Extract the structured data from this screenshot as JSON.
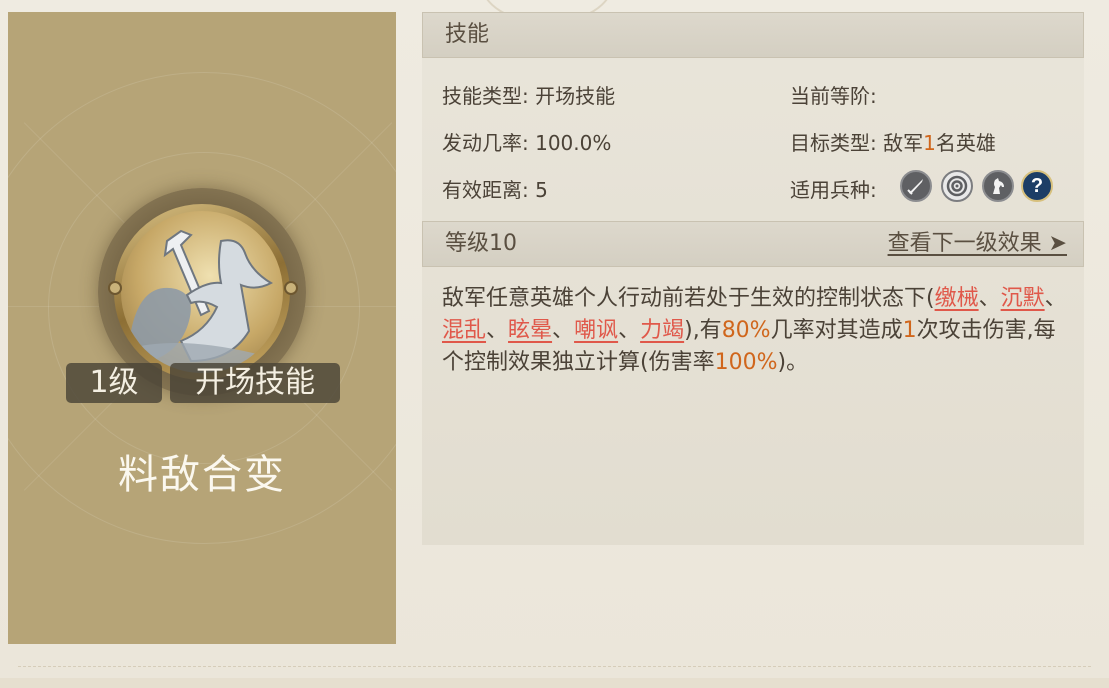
{
  "skill_card": {
    "level_tag": "1级",
    "type_tag": "开场技能",
    "name": "料敌合变"
  },
  "skill_panel": {
    "header": "技能",
    "skill_type_label": "技能类型:",
    "skill_type_value": "开场技能",
    "current_rank_label": "当前等阶:",
    "current_rank_value": "",
    "trigger_rate_label": "发动几率:",
    "trigger_rate_value": "100.0%",
    "target_label": "目标类型:",
    "target_prefix": "敌军",
    "target_count": "1",
    "target_suffix": "名英雄",
    "range_label": "有效距离:",
    "range_value": "5",
    "troops_label": "适用兵种:",
    "troop_icons": [
      "sword-troop-icon",
      "archer-troop-icon",
      "cavalry-troop-icon",
      "unknown-troop-icon"
    ]
  },
  "level_bar": {
    "label": "等级10",
    "next_link": "查看下一级效果 ➤"
  },
  "description": {
    "p1": "敌军任意英雄个人行动前若处于生效的控制状态下(",
    "kw1": "缴械",
    "s1": "、",
    "kw2": "沉默",
    "s2": "、",
    "kw3": "混乱",
    "s3": "、",
    "kw4": "眩晕",
    "s4": "、",
    "kw5": "嘲讽",
    "s5": "、",
    "kw6": "力竭",
    "p2": "),有",
    "rate": "80%",
    "p3": "几率对其造成",
    "hits": "1",
    "p4": "次攻击伤害,每个控制效果独立计算(伤害率",
    "dmg": "100%",
    "p5": ")。"
  },
  "colors": {
    "card_bg": "#b6a477",
    "highlight": "#d0661c",
    "keyword": "#e0584a",
    "text": "#4b4237"
  }
}
